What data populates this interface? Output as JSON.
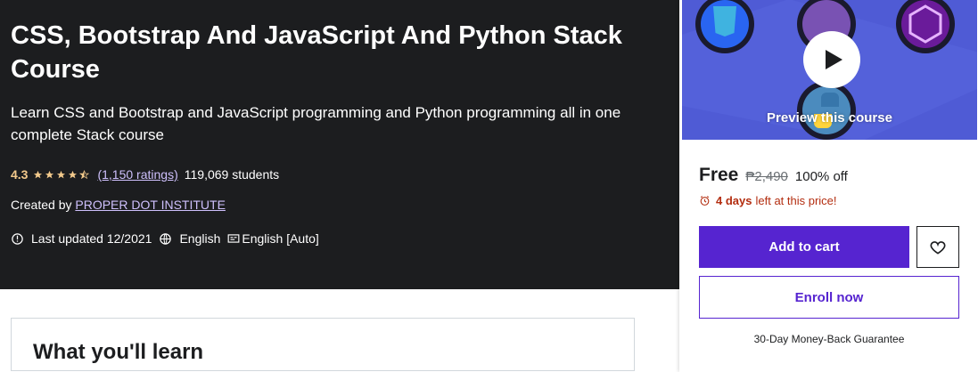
{
  "course": {
    "title": "CSS, Bootstrap And JavaScript And Python Stack Course",
    "subtitle": "Learn CSS and Bootstrap and JavaScript programming and Python programming all in one complete Stack course",
    "rating": "4.3",
    "stars": 4.3,
    "ratings_count": "(1,150 ratings)",
    "students": "119,069 students",
    "created_by_label": "Created by",
    "instructor": "PROPER DOT INSTITUTE",
    "last_updated": "Last updated 12/2021",
    "language": "English",
    "captions": "English [Auto]"
  },
  "learn": {
    "title": "What you'll learn"
  },
  "sidebar": {
    "preview_label": "Preview this course",
    "preview_logos": [
      "CSS",
      "B",
      "JS"
    ],
    "price": "Free",
    "original_price": "₱2,490",
    "discount": "100% off",
    "timer_bold": "4 days",
    "timer_text": "left at this price!",
    "add_to_cart": "Add to cart",
    "enroll_now": "Enroll now",
    "guarantee": "30-Day Money-Back Guarantee"
  },
  "colors": {
    "hero_bg": "#1c1d1f",
    "rating": "#f3ca8c",
    "link": "#cec0fc",
    "accent": "#5624d0",
    "timer": "#b32d0f",
    "preview_bg": "#4f5bd5"
  },
  "icons": {
    "star": "star-icon",
    "update": "alert-icon",
    "language": "globe-icon",
    "captions": "closed-captions-icon",
    "timer": "alarm-clock-icon",
    "wishlist": "heart-icon",
    "play": "play-icon"
  }
}
